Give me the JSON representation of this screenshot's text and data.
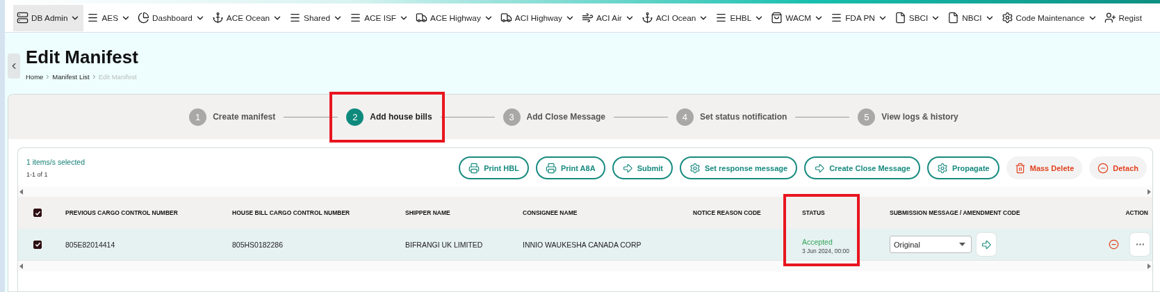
{
  "nav": {
    "items": [
      {
        "label": "DB Admin",
        "selected": true
      },
      {
        "label": "AES",
        "selected": false
      },
      {
        "label": "Dashboard",
        "selected": false
      },
      {
        "label": "ACE Ocean",
        "selected": false
      },
      {
        "label": "Shared",
        "selected": false
      },
      {
        "label": "ACE ISF",
        "selected": false
      },
      {
        "label": "ACE Highway",
        "selected": false
      },
      {
        "label": "ACI Highway",
        "selected": false
      },
      {
        "label": "ACI Air",
        "selected": false
      },
      {
        "label": "ACI Ocean",
        "selected": false
      },
      {
        "label": "EHBL",
        "selected": false
      },
      {
        "label": "WACM",
        "selected": false
      },
      {
        "label": "FDA PN",
        "selected": false
      },
      {
        "label": "SBCI",
        "selected": false
      },
      {
        "label": "NBCI",
        "selected": false
      },
      {
        "label": "Code Maintenance",
        "selected": false
      },
      {
        "label": "Regist",
        "selected": false
      }
    ]
  },
  "page": {
    "title": "Edit Manifest",
    "breadcrumb": [
      {
        "label": "Home",
        "current": false
      },
      {
        "label": "Manifest List",
        "current": false
      },
      {
        "label": "Edit Manifest",
        "current": true
      }
    ]
  },
  "steps": [
    {
      "number": "1",
      "label": "Create manifest",
      "selected": false,
      "highlighted": false
    },
    {
      "number": "2",
      "label": "Add house bills",
      "selected": true,
      "highlighted": true
    },
    {
      "number": "3",
      "label": "Add Close Message",
      "selected": false,
      "highlighted": false
    },
    {
      "number": "4",
      "label": "Set status notification",
      "selected": false,
      "highlighted": false
    },
    {
      "number": "5",
      "label": "View logs & history",
      "selected": false,
      "highlighted": false
    }
  ],
  "selection": {
    "summary": "1 items/s selected",
    "range": "1-1 of 1"
  },
  "actions": [
    {
      "label": "Print HBL",
      "kind": "outline"
    },
    {
      "label": "Print A8A",
      "kind": "outline"
    },
    {
      "label": "Submit",
      "kind": "outline"
    },
    {
      "label": "Set response message",
      "kind": "outline"
    },
    {
      "label": "Create Close Message",
      "kind": "outline"
    },
    {
      "label": "Propagate",
      "kind": "outline"
    },
    {
      "label": "Mass Delete",
      "kind": "danger"
    },
    {
      "label": "Detach",
      "kind": "danger"
    }
  ],
  "table": {
    "all_checked": true,
    "columns": [
      {
        "label": "PREVIOUS CARGO CONTROL NUMBER",
        "highlighted": false
      },
      {
        "label": "HOUSE BILL CARGO CONTROL NUMBER",
        "highlighted": false
      },
      {
        "label": "SHIPPER NAME",
        "highlighted": false
      },
      {
        "label": "CONSIGNEE NAME",
        "highlighted": false
      },
      {
        "label": "NOTICE REASON CODE",
        "highlighted": false
      },
      {
        "label": "STATUS",
        "highlighted": true
      },
      {
        "label": "SUBMISSION MESSAGE / AMENDMENT CODE",
        "highlighted": false
      },
      {
        "label": "ACTION",
        "highlighted": false
      }
    ],
    "rows": [
      {
        "checked": true,
        "selected": true,
        "previous_ccn": "805E82014414",
        "house_bill_ccn": "805HS0182286",
        "shipper": "BIFRANGI UK LIMITED",
        "consignee": "INNIO WAUKESHA CANADA CORP",
        "notice_reason_code": "",
        "status": "Accepted",
        "status_date": "3 Jun 2024, 00:00",
        "submission": "Original"
      }
    ]
  }
}
